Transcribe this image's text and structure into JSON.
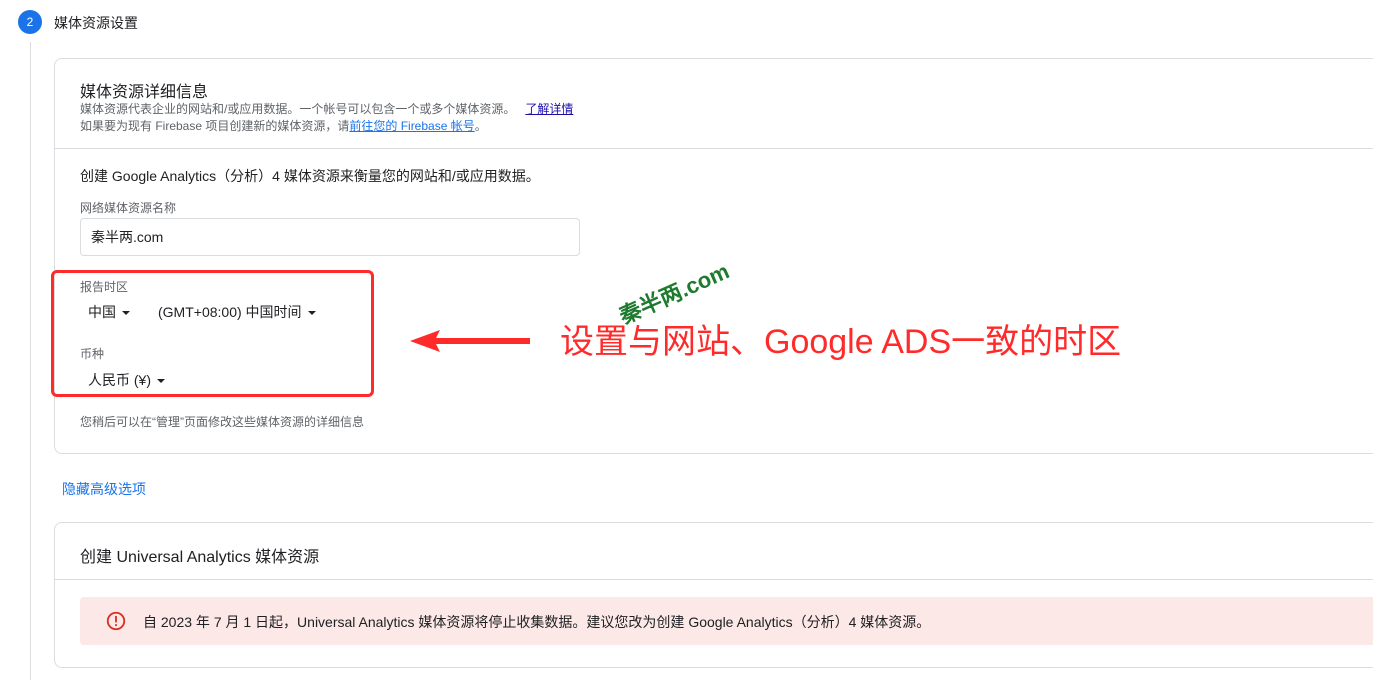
{
  "step": {
    "number": "2",
    "title": "媒体资源设置"
  },
  "details_card": {
    "title": "媒体资源详细信息",
    "desc_line1": "媒体资源代表企业的网站和/或应用数据。一个帐号可以包含一个或多个媒体资源。",
    "learn_more": "了解详情",
    "desc_line2_prefix": "如果要为现有 Firebase 项目创建新的媒体资源，请",
    "firebase_link": "前往您的 Firebase 帐号",
    "desc_line2_suffix": "。",
    "intro": "创建 Google Analytics（分析）4 媒体资源来衡量您的网站和/或应用数据。",
    "name_label": "网络媒体资源名称",
    "name_value": "秦半两.com",
    "tz_label": "报告时区",
    "country": "中国",
    "timezone": "(GMT+08:00) 中国时间",
    "currency_label": "币种",
    "currency": "人民币 (¥)",
    "footnote": "您稍后可以在“管理”页面修改这些媒体资源的详细信息"
  },
  "hide_advanced": "隐藏高级选项",
  "ua_card": {
    "title": "创建 Universal Analytics 媒体资源",
    "warning": "自 2023 年 7 月 1 日起，Universal Analytics 媒体资源将停止收集数据。建议您改为创建 Google Analytics（分析）4 媒体资源。"
  },
  "annotation": {
    "text": "设置与网站、Google ADS一致的时区",
    "watermark": "秦半两.com",
    "color": "#ff2a2a"
  },
  "colors": {
    "accent": "#1a73e8",
    "warning_bg": "#fce8e6",
    "warning_icon": "#d93025",
    "watermark": "#1e7a2e"
  }
}
